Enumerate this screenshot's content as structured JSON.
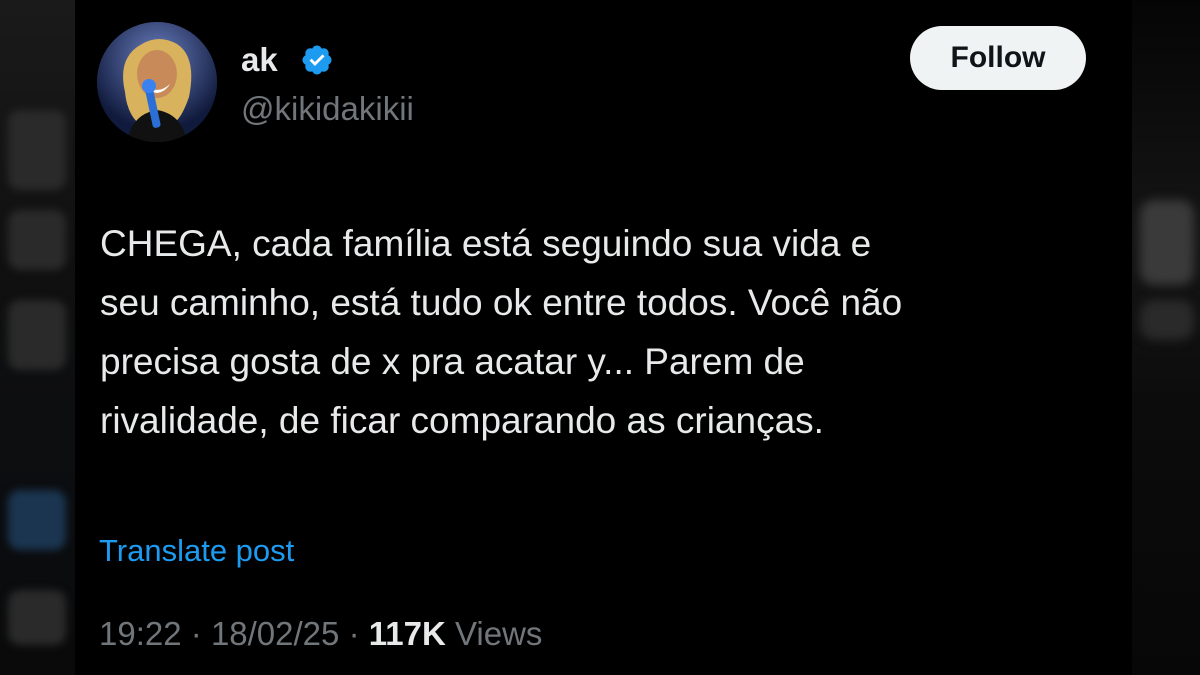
{
  "author": {
    "display_name": "ak",
    "handle": "@kikidakikii",
    "verified": true,
    "avatar_icon": "profile-photo-avatar"
  },
  "actions": {
    "follow_label": "Follow"
  },
  "tweet": {
    "lines": [
      "CHEGA, cada família está seguindo sua vida e",
      "seu caminho, está tudo ok entre todos. Você não",
      "precisa gosta de x pra acatar y... Parem de",
      "rivalidade, de ficar comparando as crianças."
    ],
    "translate_label": "Translate post"
  },
  "meta": {
    "time": "19:22",
    "separator": "·",
    "date": "18/02/25",
    "views_count": "117K",
    "views_label": "Views"
  },
  "colors": {
    "background": "#000000",
    "text_primary": "#e7e9ea",
    "text_secondary": "#71767b",
    "link": "#1d9bf0",
    "verified_badge": "#1d9bf0",
    "follow_button_bg": "#eff3f4"
  }
}
